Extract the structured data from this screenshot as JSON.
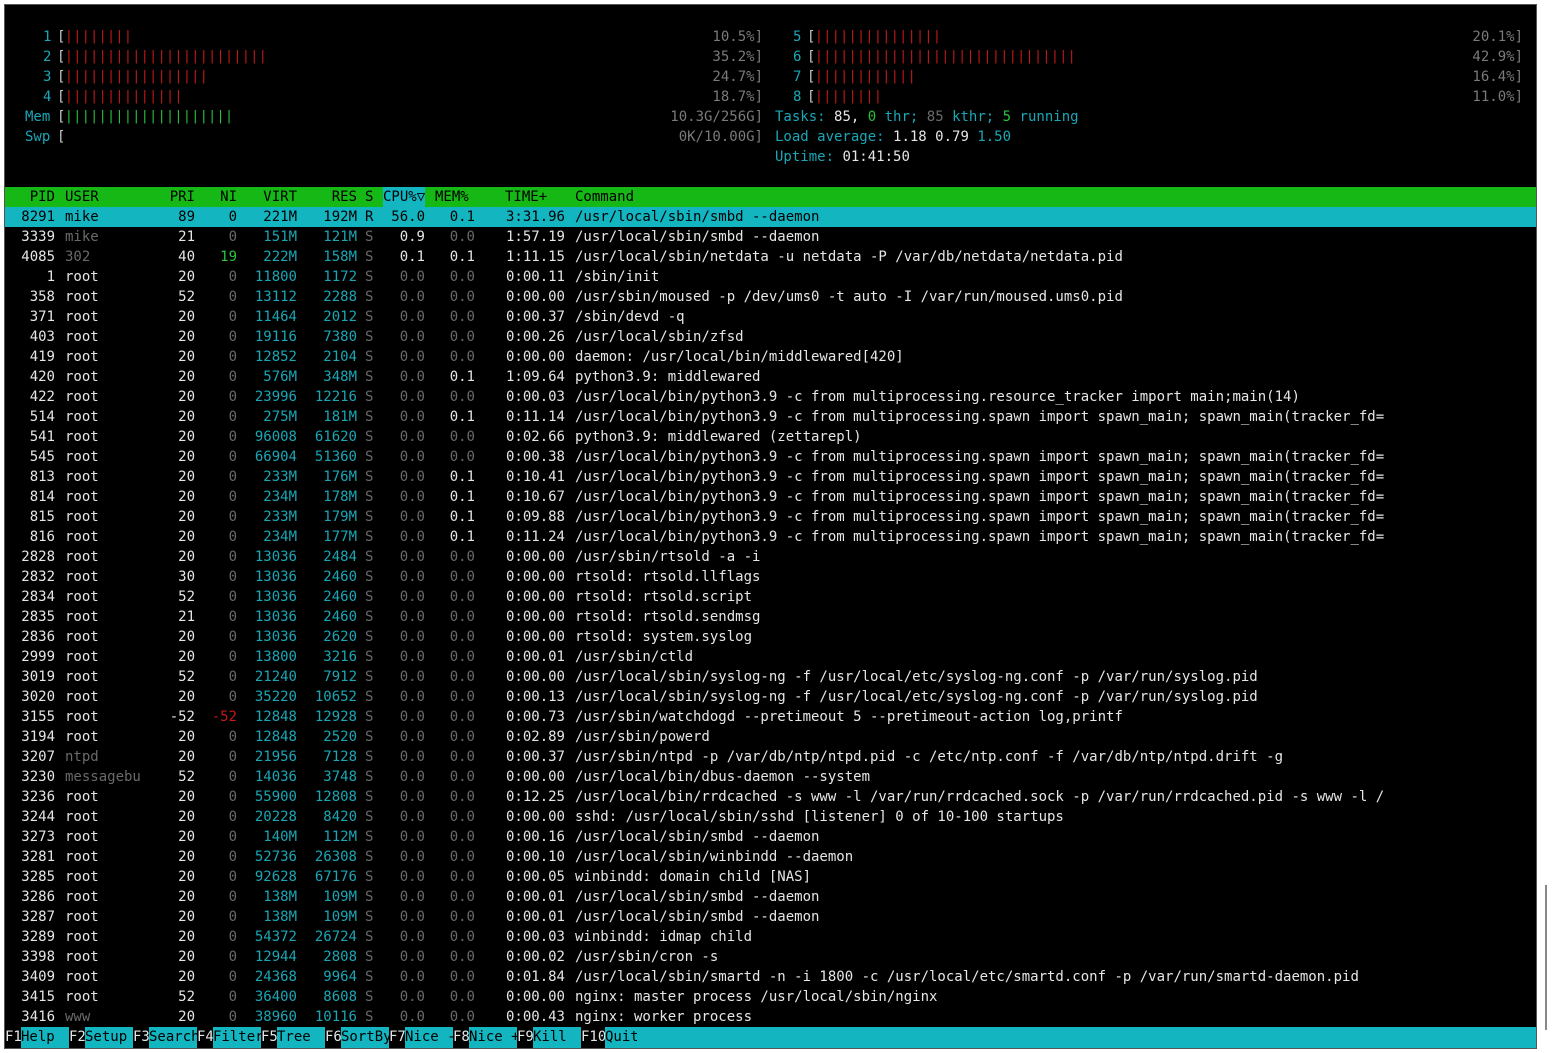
{
  "cpus": [
    {
      "id": "1",
      "bars": "||||||||",
      "pct": "10.5%]",
      "color": "red"
    },
    {
      "id": "2",
      "bars": "||||||||||||||||||||||||",
      "pct": "35.2%]",
      "color": "red"
    },
    {
      "id": "3",
      "bars": "|||||||||||||||||",
      "pct": "24.7%]",
      "color": "red"
    },
    {
      "id": "4",
      "bars": "||||||||||||||",
      "pct": "18.7%]",
      "color": "red"
    },
    {
      "id": "5",
      "bars": "|||||||||||||||",
      "pct": "20.1%]",
      "color": "red"
    },
    {
      "id": "6",
      "bars": "|||||||||||||||||||||||||||||||",
      "pct": "42.9%]",
      "color": "red"
    },
    {
      "id": "7",
      "bars": "||||||||||||",
      "pct": "16.4%]",
      "color": "red"
    },
    {
      "id": "8",
      "bars": "||||||||",
      "pct": "11.0%]",
      "color": "red"
    }
  ],
  "mem": {
    "label": "Mem",
    "bars": "||||||||||||||||||||",
    "value": "10.3G/256G]"
  },
  "swp": {
    "label": "Swp",
    "bars": "",
    "value": "0K/10.00G]"
  },
  "tasks": {
    "label": "Tasks:",
    "count": "85,",
    "thr": "0",
    "thr_label": "thr;",
    "kthr": "85",
    "kthr_label": "kthr;",
    "running": "5",
    "running_label": "running"
  },
  "load": {
    "label": "Load average:",
    "v1": "1.18",
    "v5": "0.79",
    "v15": "1.50"
  },
  "uptime": {
    "label": "Uptime:",
    "value": "01:41:50"
  },
  "columns": {
    "pid": "PID",
    "user": "USER",
    "pri": "PRI",
    "ni": "NI",
    "virt": "VIRT",
    "res": "RES",
    "s": "S",
    "cpu": "CPU%",
    "sort_arrow": "▽",
    "mem": "MEM%",
    "time": "TIME+",
    "cmd": "Command"
  },
  "processes": [
    {
      "pid": "8291",
      "user": "mike",
      "pri": "89",
      "ni": "0",
      "virt": "221M",
      "res": "192M",
      "s": "R",
      "cpu": "56.0",
      "mem": "0.1",
      "time": "3:31.96",
      "cmd": "/usr/local/sbin/smbd --daemon",
      "selected": true
    },
    {
      "pid": "3339",
      "user": "mike",
      "pri": "21",
      "ni": "0",
      "virt": "151M",
      "res": "121M",
      "s": "S",
      "cpu": "0.9",
      "mem": "0.0",
      "time": "1:57.19",
      "cmd": "/usr/local/sbin/smbd --daemon"
    },
    {
      "pid": "4085",
      "user": "302",
      "pri": "40",
      "ni": "19",
      "virt": "222M",
      "res": "158M",
      "s": "S",
      "cpu": "0.1",
      "mem": "0.1",
      "time": "1:11.15",
      "cmd": "/usr/local/sbin/netdata -u netdata -P /var/db/netdata/netdata.pid"
    },
    {
      "pid": "1",
      "user": "root",
      "pri": "20",
      "ni": "0",
      "virt": "11800",
      "res": "1172",
      "s": "S",
      "cpu": "0.0",
      "mem": "0.0",
      "time": "0:00.11",
      "cmd": "/sbin/init"
    },
    {
      "pid": "358",
      "user": "root",
      "pri": "52",
      "ni": "0",
      "virt": "13112",
      "res": "2288",
      "s": "S",
      "cpu": "0.0",
      "mem": "0.0",
      "time": "0:00.00",
      "cmd": "/usr/sbin/moused -p /dev/ums0 -t auto -I /var/run/moused.ums0.pid"
    },
    {
      "pid": "371",
      "user": "root",
      "pri": "20",
      "ni": "0",
      "virt": "11464",
      "res": "2012",
      "s": "S",
      "cpu": "0.0",
      "mem": "0.0",
      "time": "0:00.37",
      "cmd": "/sbin/devd -q"
    },
    {
      "pid": "403",
      "user": "root",
      "pri": "20",
      "ni": "0",
      "virt": "19116",
      "res": "7380",
      "s": "S",
      "cpu": "0.0",
      "mem": "0.0",
      "time": "0:00.26",
      "cmd": "/usr/local/sbin/zfsd"
    },
    {
      "pid": "419",
      "user": "root",
      "pri": "20",
      "ni": "0",
      "virt": "12852",
      "res": "2104",
      "s": "S",
      "cpu": "0.0",
      "mem": "0.0",
      "time": "0:00.00",
      "cmd": "daemon: /usr/local/bin/middlewared[420]"
    },
    {
      "pid": "420",
      "user": "root",
      "pri": "20",
      "ni": "0",
      "virt": "576M",
      "res": "348M",
      "s": "S",
      "cpu": "0.0",
      "mem": "0.1",
      "time": "1:09.64",
      "cmd": "python3.9: middlewared"
    },
    {
      "pid": "422",
      "user": "root",
      "pri": "20",
      "ni": "0",
      "virt": "23996",
      "res": "12216",
      "s": "S",
      "cpu": "0.0",
      "mem": "0.0",
      "time": "0:00.03",
      "cmd": "/usr/local/bin/python3.9 -c from multiprocessing.resource_tracker import main;main(14)"
    },
    {
      "pid": "514",
      "user": "root",
      "pri": "20",
      "ni": "0",
      "virt": "275M",
      "res": "181M",
      "s": "S",
      "cpu": "0.0",
      "mem": "0.1",
      "time": "0:11.14",
      "cmd": "/usr/local/bin/python3.9 -c from multiprocessing.spawn import spawn_main; spawn_main(tracker_fd="
    },
    {
      "pid": "541",
      "user": "root",
      "pri": "20",
      "ni": "0",
      "virt": "96008",
      "res": "61620",
      "s": "S",
      "cpu": "0.0",
      "mem": "0.0",
      "time": "0:02.66",
      "cmd": "python3.9: middlewared (zettarepl)"
    },
    {
      "pid": "545",
      "user": "root",
      "pri": "20",
      "ni": "0",
      "virt": "66904",
      "res": "51360",
      "s": "S",
      "cpu": "0.0",
      "mem": "0.0",
      "time": "0:00.38",
      "cmd": "/usr/local/bin/python3.9 -c from multiprocessing.spawn import spawn_main; spawn_main(tracker_fd="
    },
    {
      "pid": "813",
      "user": "root",
      "pri": "20",
      "ni": "0",
      "virt": "233M",
      "res": "176M",
      "s": "S",
      "cpu": "0.0",
      "mem": "0.1",
      "time": "0:10.41",
      "cmd": "/usr/local/bin/python3.9 -c from multiprocessing.spawn import spawn_main; spawn_main(tracker_fd="
    },
    {
      "pid": "814",
      "user": "root",
      "pri": "20",
      "ni": "0",
      "virt": "234M",
      "res": "178M",
      "s": "S",
      "cpu": "0.0",
      "mem": "0.1",
      "time": "0:10.67",
      "cmd": "/usr/local/bin/python3.9 -c from multiprocessing.spawn import spawn_main; spawn_main(tracker_fd="
    },
    {
      "pid": "815",
      "user": "root",
      "pri": "20",
      "ni": "0",
      "virt": "233M",
      "res": "179M",
      "s": "S",
      "cpu": "0.0",
      "mem": "0.1",
      "time": "0:09.88",
      "cmd": "/usr/local/bin/python3.9 -c from multiprocessing.spawn import spawn_main; spawn_main(tracker_fd="
    },
    {
      "pid": "816",
      "user": "root",
      "pri": "20",
      "ni": "0",
      "virt": "234M",
      "res": "177M",
      "s": "S",
      "cpu": "0.0",
      "mem": "0.1",
      "time": "0:11.24",
      "cmd": "/usr/local/bin/python3.9 -c from multiprocessing.spawn import spawn_main; spawn_main(tracker_fd="
    },
    {
      "pid": "2828",
      "user": "root",
      "pri": "20",
      "ni": "0",
      "virt": "13036",
      "res": "2484",
      "s": "S",
      "cpu": "0.0",
      "mem": "0.0",
      "time": "0:00.00",
      "cmd": "/usr/sbin/rtsold -a -i"
    },
    {
      "pid": "2832",
      "user": "root",
      "pri": "30",
      "ni": "0",
      "virt": "13036",
      "res": "2460",
      "s": "S",
      "cpu": "0.0",
      "mem": "0.0",
      "time": "0:00.00",
      "cmd": "rtsold: rtsold.llflags"
    },
    {
      "pid": "2834",
      "user": "root",
      "pri": "52",
      "ni": "0",
      "virt": "13036",
      "res": "2460",
      "s": "S",
      "cpu": "0.0",
      "mem": "0.0",
      "time": "0:00.00",
      "cmd": "rtsold: rtsold.script"
    },
    {
      "pid": "2835",
      "user": "root",
      "pri": "21",
      "ni": "0",
      "virt": "13036",
      "res": "2460",
      "s": "S",
      "cpu": "0.0",
      "mem": "0.0",
      "time": "0:00.00",
      "cmd": "rtsold: rtsold.sendmsg"
    },
    {
      "pid": "2836",
      "user": "root",
      "pri": "20",
      "ni": "0",
      "virt": "13036",
      "res": "2620",
      "s": "S",
      "cpu": "0.0",
      "mem": "0.0",
      "time": "0:00.00",
      "cmd": "rtsold: system.syslog"
    },
    {
      "pid": "2999",
      "user": "root",
      "pri": "20",
      "ni": "0",
      "virt": "13800",
      "res": "3216",
      "s": "S",
      "cpu": "0.0",
      "mem": "0.0",
      "time": "0:00.01",
      "cmd": "/usr/sbin/ctld"
    },
    {
      "pid": "3019",
      "user": "root",
      "pri": "52",
      "ni": "0",
      "virt": "21240",
      "res": "7912",
      "s": "S",
      "cpu": "0.0",
      "mem": "0.0",
      "time": "0:00.00",
      "cmd": "/usr/local/sbin/syslog-ng -f /usr/local/etc/syslog-ng.conf -p /var/run/syslog.pid"
    },
    {
      "pid": "3020",
      "user": "root",
      "pri": "20",
      "ni": "0",
      "virt": "35220",
      "res": "10652",
      "s": "S",
      "cpu": "0.0",
      "mem": "0.0",
      "time": "0:00.13",
      "cmd": "/usr/local/sbin/syslog-ng -f /usr/local/etc/syslog-ng.conf -p /var/run/syslog.pid"
    },
    {
      "pid": "3155",
      "user": "root",
      "pri": "-52",
      "ni": "-52",
      "virt": "12848",
      "res": "12928",
      "s": "S",
      "cpu": "0.0",
      "mem": "0.0",
      "time": "0:00.73",
      "cmd": "/usr/sbin/watchdogd --pretimeout 5 --pretimeout-action log,printf"
    },
    {
      "pid": "3194",
      "user": "root",
      "pri": "20",
      "ni": "0",
      "virt": "12848",
      "res": "2520",
      "s": "S",
      "cpu": "0.0",
      "mem": "0.0",
      "time": "0:02.89",
      "cmd": "/usr/sbin/powerd"
    },
    {
      "pid": "3207",
      "user": "ntpd",
      "pri": "20",
      "ni": "0",
      "virt": "21956",
      "res": "7128",
      "s": "S",
      "cpu": "0.0",
      "mem": "0.0",
      "time": "0:00.37",
      "cmd": "/usr/sbin/ntpd -p /var/db/ntp/ntpd.pid -c /etc/ntp.conf -f /var/db/ntp/ntpd.drift -g"
    },
    {
      "pid": "3230",
      "user": "messagebu",
      "pri": "52",
      "ni": "0",
      "virt": "14036",
      "res": "3748",
      "s": "S",
      "cpu": "0.0",
      "mem": "0.0",
      "time": "0:00.00",
      "cmd": "/usr/local/bin/dbus-daemon --system"
    },
    {
      "pid": "3236",
      "user": "root",
      "pri": "20",
      "ni": "0",
      "virt": "55900",
      "res": "12808",
      "s": "S",
      "cpu": "0.0",
      "mem": "0.0",
      "time": "0:12.25",
      "cmd": "/usr/local/bin/rrdcached -s www -l /var/run/rrdcached.sock -p /var/run/rrdcached.pid -s www -l /"
    },
    {
      "pid": "3244",
      "user": "root",
      "pri": "20",
      "ni": "0",
      "virt": "20228",
      "res": "8420",
      "s": "S",
      "cpu": "0.0",
      "mem": "0.0",
      "time": "0:00.00",
      "cmd": "sshd: /usr/local/sbin/sshd [listener] 0 of 10-100 startups"
    },
    {
      "pid": "3273",
      "user": "root",
      "pri": "20",
      "ni": "0",
      "virt": "140M",
      "res": "112M",
      "s": "S",
      "cpu": "0.0",
      "mem": "0.0",
      "time": "0:00.16",
      "cmd": "/usr/local/sbin/smbd --daemon"
    },
    {
      "pid": "3281",
      "user": "root",
      "pri": "20",
      "ni": "0",
      "virt": "52736",
      "res": "26308",
      "s": "S",
      "cpu": "0.0",
      "mem": "0.0",
      "time": "0:00.10",
      "cmd": "/usr/local/sbin/winbindd --daemon"
    },
    {
      "pid": "3285",
      "user": "root",
      "pri": "20",
      "ni": "0",
      "virt": "92628",
      "res": "67176",
      "s": "S",
      "cpu": "0.0",
      "mem": "0.0",
      "time": "0:00.05",
      "cmd": "winbindd: domain child [NAS]"
    },
    {
      "pid": "3286",
      "user": "root",
      "pri": "20",
      "ni": "0",
      "virt": "138M",
      "res": "109M",
      "s": "S",
      "cpu": "0.0",
      "mem": "0.0",
      "time": "0:00.01",
      "cmd": "/usr/local/sbin/smbd --daemon"
    },
    {
      "pid": "3287",
      "user": "root",
      "pri": "20",
      "ni": "0",
      "virt": "138M",
      "res": "109M",
      "s": "S",
      "cpu": "0.0",
      "mem": "0.0",
      "time": "0:00.01",
      "cmd": "/usr/local/sbin/smbd --daemon"
    },
    {
      "pid": "3289",
      "user": "root",
      "pri": "20",
      "ni": "0",
      "virt": "54372",
      "res": "26724",
      "s": "S",
      "cpu": "0.0",
      "mem": "0.0",
      "time": "0:00.03",
      "cmd": "winbindd: idmap child"
    },
    {
      "pid": "3398",
      "user": "root",
      "pri": "20",
      "ni": "0",
      "virt": "12944",
      "res": "2808",
      "s": "S",
      "cpu": "0.0",
      "mem": "0.0",
      "time": "0:00.02",
      "cmd": "/usr/sbin/cron -s"
    },
    {
      "pid": "3409",
      "user": "root",
      "pri": "20",
      "ni": "0",
      "virt": "24368",
      "res": "9964",
      "s": "S",
      "cpu": "0.0",
      "mem": "0.0",
      "time": "0:01.84",
      "cmd": "/usr/local/sbin/smartd -n -i 1800 -c /usr/local/etc/smartd.conf -p /var/run/smartd-daemon.pid"
    },
    {
      "pid": "3415",
      "user": "root",
      "pri": "52",
      "ni": "0",
      "virt": "36400",
      "res": "8608",
      "s": "S",
      "cpu": "0.0",
      "mem": "0.0",
      "time": "0:00.00",
      "cmd": "nginx: master process /usr/local/sbin/nginx"
    },
    {
      "pid": "3416",
      "user": "www",
      "pri": "20",
      "ni": "0",
      "virt": "38960",
      "res": "10116",
      "s": "S",
      "cpu": "0.0",
      "mem": "0.0",
      "time": "0:00.43",
      "cmd": "nginx: worker process"
    }
  ],
  "fkeys": [
    {
      "key": "F1",
      "label": "Help  "
    },
    {
      "key": "F2",
      "label": "Setup "
    },
    {
      "key": "F3",
      "label": "Search"
    },
    {
      "key": "F4",
      "label": "Filter"
    },
    {
      "key": "F5",
      "label": "Tree  "
    },
    {
      "key": "F6",
      "label": "SortBy"
    },
    {
      "key": "F7",
      "label": "Nice -"
    },
    {
      "key": "F8",
      "label": "Nice +"
    },
    {
      "key": "F9",
      "label": "Kill  "
    },
    {
      "key": "F10",
      "label": "Quit"
    }
  ],
  "colors": {
    "bg": "#000000",
    "cyan": "#1aa6b5",
    "green": "#16b816",
    "red": "#c41a1a",
    "selection": "#12b5c0"
  }
}
